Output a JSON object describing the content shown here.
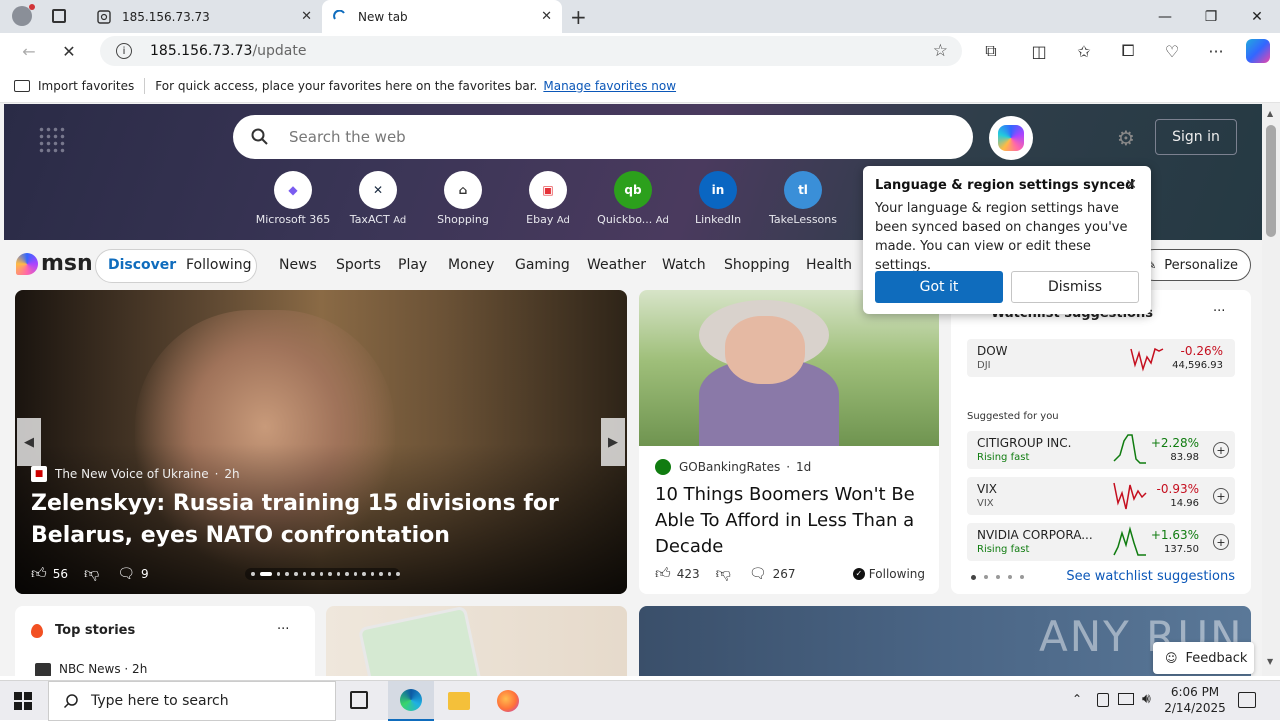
{
  "tabs": [
    {
      "title": "185.156.73.73"
    },
    {
      "title": "New tab"
    }
  ],
  "address": {
    "host": "185.156.73.73",
    "path": "/update"
  },
  "favbar": {
    "import_label": "Import favorites",
    "hint": "For quick access, place your favorites here on the favorites bar.",
    "manage_link": "Manage favorites now"
  },
  "search": {
    "placeholder": "Search the web"
  },
  "signin": "Sign in",
  "quick_links": [
    {
      "label": "Microsoft 365",
      "ad": ""
    },
    {
      "label": "TaxACT",
      "ad": "Ad"
    },
    {
      "label": "Shopping",
      "ad": ""
    },
    {
      "label": "Ebay",
      "ad": "Ad"
    },
    {
      "label": "Quickbo...",
      "ad": "Ad"
    },
    {
      "label": "LinkedIn",
      "ad": ""
    },
    {
      "label": "TakeLessons",
      "ad": ""
    }
  ],
  "nav": {
    "logo": "msn",
    "discover": "Discover",
    "following": "Following",
    "items": [
      "News",
      "Sports",
      "Play",
      "Money",
      "Gaming",
      "Weather",
      "Watch",
      "Shopping",
      "Health"
    ],
    "personalize": "Personalize"
  },
  "hero_story": {
    "source": "The New Voice of Ukraine",
    "age": "2h",
    "headline": "Zelenskyy: Russia training 15 divisions for Belarus, eyes NATO confrontation",
    "likes": "56",
    "comments": "9"
  },
  "side_story": {
    "source": "GOBankingRates",
    "age": "1d",
    "headline": "10 Things Boomers Won't Be Able To Afford in Less Than a Decade",
    "likes": "423",
    "comments": "267",
    "following": "Following"
  },
  "popup": {
    "title": "Language & region settings synced",
    "body": "Your language & region settings have been synced based on changes you've made. You can view or edit these settings.",
    "primary": "Got it",
    "secondary": "Dismiss"
  },
  "watchlist": {
    "title": "Watchlist suggestions",
    "index": {
      "symbol": "DOW",
      "sub": "DJI",
      "change": "-0.26%",
      "value": "44,596.93"
    },
    "suggested_label": "Suggested for you",
    "stocks": [
      {
        "name": "CITIGROUP INC.",
        "sub": "Rising fast",
        "change": "+2.28%",
        "value": "83.98"
      },
      {
        "name": "VIX",
        "sub": "VIX",
        "change": "-0.93%",
        "value": "14.96"
      },
      {
        "name": "NVIDIA CORPORA...",
        "sub": "Rising fast",
        "change": "+1.63%",
        "value": "137.50"
      }
    ],
    "see_link": "See watchlist suggestions"
  },
  "top_stories": {
    "title": "Top stories",
    "first_source": "NBC News · 2h"
  },
  "feedback": "Feedback",
  "watermark": "ANY RUN",
  "taskbar": {
    "search_placeholder": "Type here to search",
    "time": "6:06 PM",
    "date": "2/14/2025"
  },
  "colors": {
    "accent": "#0f6cbd",
    "positive": "#107c10",
    "negative": "#c50f1f",
    "link": "#0b57b8"
  }
}
